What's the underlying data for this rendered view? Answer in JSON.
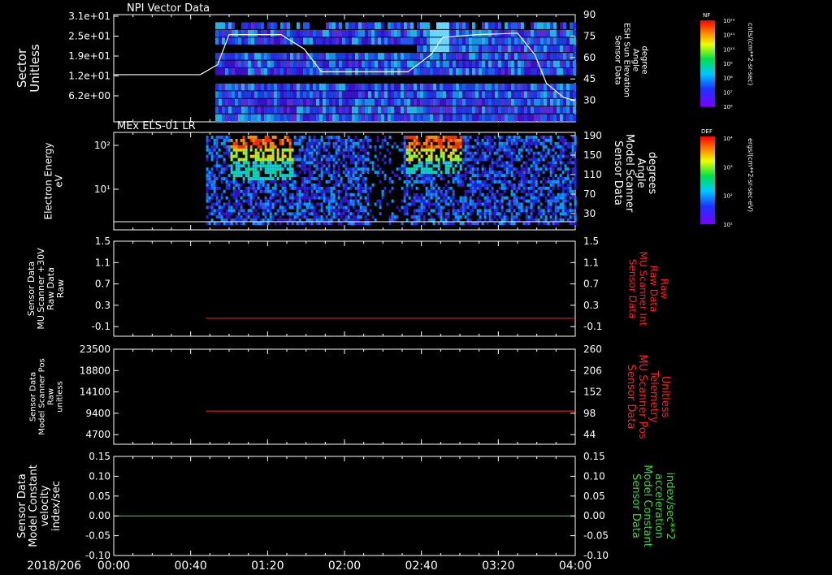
{
  "date_label": "2018/206",
  "time_ticks": [
    "00:00",
    "00:40",
    "01:20",
    "02:00",
    "02:40",
    "03:20",
    "04:00"
  ],
  "colors": {
    "axis": "#ffffff",
    "red_series": "#ff2020",
    "green_series": "#33dd33",
    "background": "#000000"
  },
  "colorbars": [
    {
      "title": "NF",
      "units": "cnts/(cm**2-sr-sec)",
      "tick_labels": [
        "10¹²",
        "10¹¹",
        "10¹⁰",
        "10⁹",
        "10⁸",
        "10⁷",
        "10⁶"
      ]
    },
    {
      "title": "DEF",
      "units": "ergs/(cm**2-sr-sec-eV)",
      "tick_labels": [
        "10⁴",
        "10³",
        "10²",
        "10¹"
      ]
    }
  ],
  "chart_data": [
    {
      "type": "heatmap",
      "title": "NPI Vector Data",
      "ylabel": [
        "Sector",
        "Unitless"
      ],
      "yticks": [
        "3.1e+01",
        "2.5e+01",
        "1.9e+01",
        "1.2e+01",
        "6.2e+00"
      ],
      "right_ylabel": [
        "Sensor Data",
        "ESH Sun Elevation",
        "Angle",
        "degree"
      ],
      "right_yticks": [
        "90",
        "75",
        "60",
        "45",
        "30"
      ],
      "overlay_line": {
        "color": "#ffffff",
        "x_hours": [
          0,
          0.75,
          0.9,
          1.0,
          1.45,
          1.65,
          1.8,
          2.1,
          2.55,
          2.75,
          2.85,
          3.15,
          3.5,
          3.65,
          3.75,
          3.9,
          4.0
        ],
        "y_degrees": [
          48,
          48,
          55,
          76,
          76,
          66,
          50,
          50,
          50,
          62,
          74,
          76,
          77,
          62,
          42,
          32,
          30
        ]
      }
    },
    {
      "type": "heatmap",
      "title": "MEx ELS-01 LR",
      "ylabel": [
        "Electron Energy",
        "eV"
      ],
      "yticks": [
        "10²",
        "10¹"
      ],
      "right_ylabel": [
        "Sensor Data",
        "Model Scanner",
        "Angle",
        "degrees"
      ],
      "right_yticks": [
        "190",
        "150",
        "110",
        "70",
        "30"
      ]
    },
    {
      "type": "line",
      "ylabel": [
        "Sensor Data",
        "MU Scanner +30V",
        "Raw Data",
        "Raw"
      ],
      "yticks": [
        "1.5",
        "1.1",
        "0.7",
        "0.3",
        "-0.1"
      ],
      "ylim": [
        -0.35,
        1.5
      ],
      "right_ylabel": [
        "Sensor Data",
        "MU Scanner Int",
        "Raw Data",
        "Raw"
      ],
      "right_yticks": [
        "1.5",
        "1.1",
        "0.7",
        "0.3",
        "-0.1"
      ],
      "series": [
        {
          "color": "#ff2020",
          "x_hours": [
            0.8,
            4.0
          ],
          "y": [
            0.0,
            0.0
          ]
        }
      ]
    },
    {
      "type": "line",
      "ylabel": [
        "Sensor Data",
        "Model Scanner Pos",
        "Raw",
        "unitless"
      ],
      "yticks": [
        "23500",
        "18800",
        "14100",
        "9400",
        "4700"
      ],
      "ylim": [
        0,
        23500
      ],
      "right_ylabel": [
        "Sensor Data",
        "MU Scanner Pos",
        "Telemetry",
        "Unitless"
      ],
      "right_yticks": [
        "260",
        "206",
        "152",
        "98",
        "44"
      ],
      "series": [
        {
          "color": "#ff2020",
          "x_hours": [
            0.8,
            4.0
          ],
          "y": [
            8200,
            8200
          ]
        }
      ]
    },
    {
      "type": "line",
      "ylabel": [
        "Sensor Data",
        "Model Constant",
        "velocity",
        "index/sec"
      ],
      "yticks": [
        "0.15",
        "0.10",
        "0.05",
        "0.00",
        "-0.05",
        "-0.10"
      ],
      "ylim": [
        -0.1,
        0.15
      ],
      "right_ylabel": [
        "Sensor Data",
        "Model Constant",
        "acceleration",
        "index/sec**2"
      ],
      "right_yticks": [
        "0.15",
        "0.10",
        "0.05",
        "0.00",
        "-0.05",
        "-0.10"
      ],
      "series": [
        {
          "color": "#33dd33",
          "x_hours": [
            0,
            4.0
          ],
          "y": [
            0.0,
            0.0
          ]
        }
      ]
    }
  ]
}
